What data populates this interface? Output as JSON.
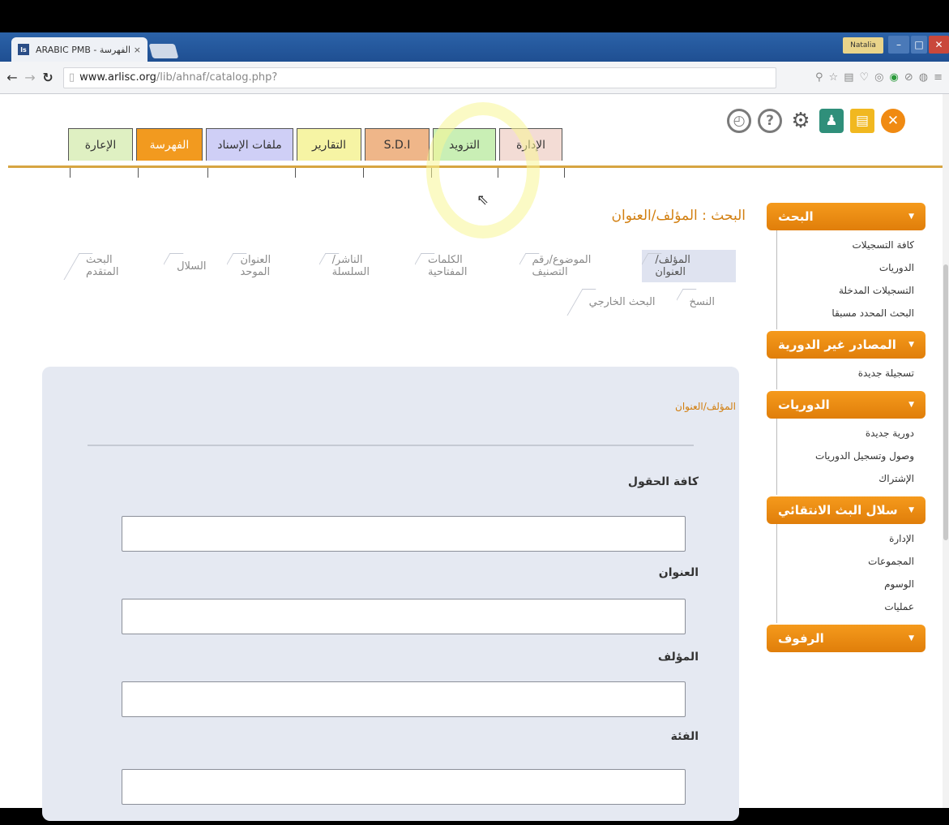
{
  "browser": {
    "tab_title": "ARABIC PMB - الفهرسة",
    "tab_close": "×",
    "favicon": "ls",
    "user_badge": "Natalia",
    "url_host": "www.arlisc.org",
    "url_path": "/lib/ahnaf/catalog.php?",
    "icons": [
      "back-arrow-icon",
      "forward-arrow-icon",
      "reload-icon",
      "page-icon",
      "zoom-icon",
      "star-icon",
      "extension-icons",
      "menu-icon"
    ]
  },
  "toolbar": {
    "icons": [
      {
        "name": "close-circle-icon",
        "color": "#f08a12"
      },
      {
        "name": "save-icon",
        "color": "#f1b820"
      },
      {
        "name": "users-icon",
        "color": "#2f8f7a"
      },
      {
        "name": "settings-gear-icon",
        "color": "#555555"
      },
      {
        "name": "help-icon",
        "color": "#7a7a7a"
      },
      {
        "name": "clock-icon",
        "color": "#7a7a7a"
      }
    ]
  },
  "top_tabs": [
    {
      "label": "الإعارة",
      "bg": "#dff0c2"
    },
    {
      "label": "الفهرسة",
      "bg": "#f29a1f",
      "active": true
    },
    {
      "label": "ملفات الإسناد",
      "bg": "#cfcff6"
    },
    {
      "label": "التقارير",
      "bg": "#f6f4a4"
    },
    {
      "label": "S.D.I",
      "bg": "#efb689"
    },
    {
      "label": "التزويد",
      "bg": "#c9efb5"
    },
    {
      "label": "الإدارة",
      "bg": "#f3dcd5"
    }
  ],
  "side_menu": [
    {
      "header": "البحث",
      "items": [
        "كافة التسجيلات",
        "الدوريات",
        "التسجيلات المدخلة",
        "البحث المحدد مسبقا"
      ]
    },
    {
      "header": "المصادر غير الدورية",
      "items": [
        "تسجيلة جديدة"
      ]
    },
    {
      "header": "الدوريات",
      "items": [
        "دورية جديدة",
        "وصول وتسجيل الدوريات",
        "الإشتراك"
      ]
    },
    {
      "header": "سلال البث الانتقائي",
      "items": [
        "الإدارة",
        "المجموعات",
        "الوسوم",
        "عمليات"
      ]
    },
    {
      "header": "الرفوف",
      "items": []
    }
  ],
  "search_title": "البحث : المؤلف/العنوان",
  "crumbs_row1": [
    "المؤلف/العنوان",
    "الموضوع/رقم التصنيف",
    "الكلمات المفتاحية",
    "الناشر/السلسلة",
    "العنوان الموحد",
    "السلال",
    "البحث المتقدم"
  ],
  "crumbs_row2": [
    "النسخ",
    "البحث الخارجي"
  ],
  "form": {
    "title": "المؤلف/العنوان",
    "fields": [
      {
        "label": "كافة الحقول",
        "value": ""
      },
      {
        "label": "العنوان",
        "value": ""
      },
      {
        "label": "المؤلف",
        "value": ""
      },
      {
        "label": "الفئة",
        "value": ""
      }
    ]
  }
}
